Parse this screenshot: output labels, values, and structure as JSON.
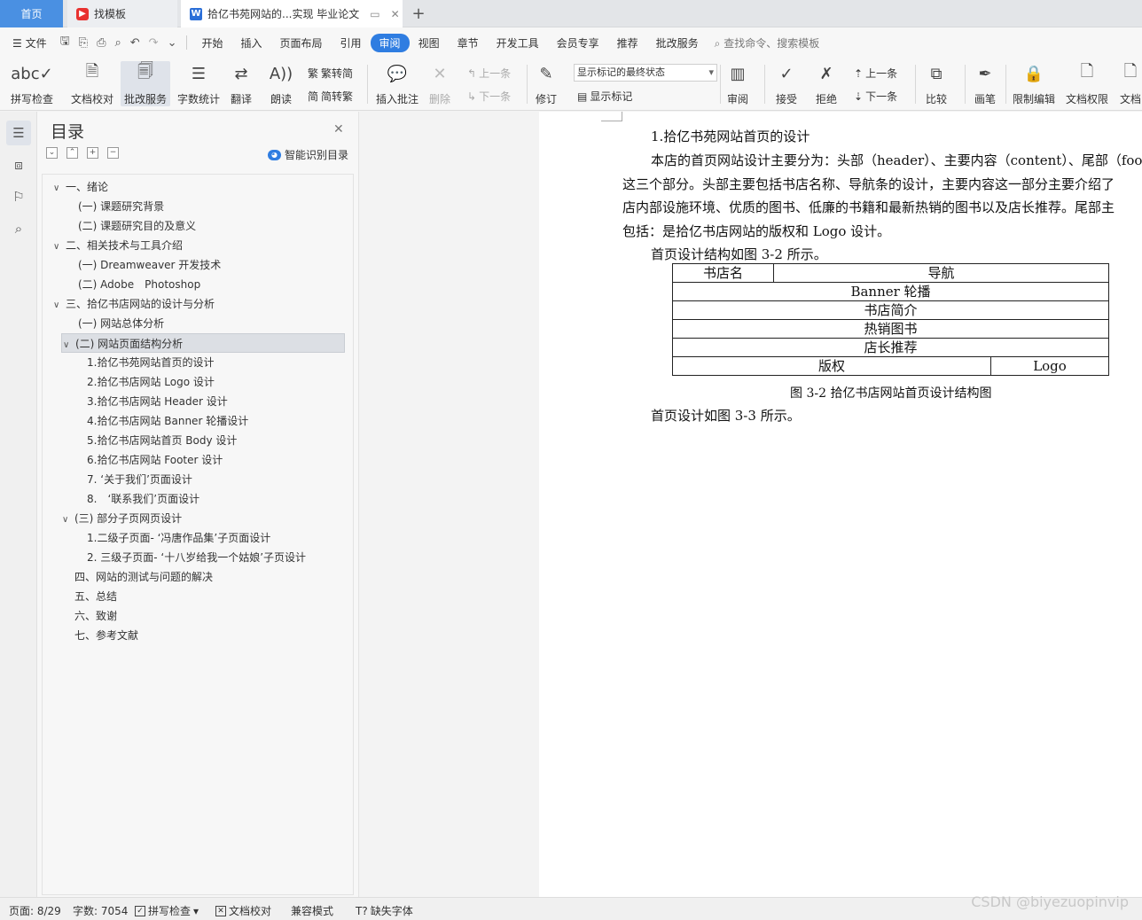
{
  "tabs": {
    "home": "首页",
    "templates": "找模板",
    "document": "拾亿书苑网站的...实现 毕业论文"
  },
  "menu": {
    "file": "文件",
    "items": [
      "开始",
      "插入",
      "页面布局",
      "引用",
      "审阅",
      "视图",
      "章节",
      "开发工具",
      "会员专享",
      "推荐",
      "批改服务"
    ],
    "active": "审阅",
    "search": "查找命令、搜索模板"
  },
  "ribbon": {
    "spellcheck": "拼写检查",
    "doc_proof": "文档校对",
    "correct_service": "批改服务",
    "word_count": "字数统计",
    "translate": "翻译",
    "read_aloud": "朗读",
    "trad_to_simp": "繁转简",
    "simp_to_trad": "简转繁",
    "insert_comment": "插入批注",
    "delete": "删除",
    "prev_comment": "上一条",
    "next_comment": "下一条",
    "revise": "修订",
    "markup_state": "显示标记的最终状态",
    "show_markup": "显示标记",
    "review": "审阅",
    "accept": "接受",
    "reject": "拒绝",
    "prev_change": "上一条",
    "next_change": "下一条",
    "compare": "比较",
    "pen": "画笔",
    "restrict_edit": "限制编辑",
    "doc_permission": "文档权限",
    "doc_more": "文档"
  },
  "toc": {
    "title": "目录",
    "smart": "智能识别目录",
    "items": [
      {
        "text": "一、绪论"
      },
      {
        "text": "(一) 课题研究背景"
      },
      {
        "text": "(二) 课题研究目的及意义"
      },
      {
        "text": "二、相关技术与工具介绍"
      },
      {
        "text": "(一) Dreamweaver 开发技术"
      },
      {
        "text": "(二) Adobe　Photoshop"
      },
      {
        "text": "三、拾亿书店网站的设计与分析"
      },
      {
        "text": "(一) 网站总体分析"
      },
      {
        "text": "(二) 网站页面结构分析"
      },
      {
        "text": "1.拾亿书苑网站首页的设计"
      },
      {
        "text": "2.拾亿书店网站 Logo 设计"
      },
      {
        "text": "3.拾亿书店网站 Header 设计"
      },
      {
        "text": "4.拾亿书店网站 Banner 轮播设计"
      },
      {
        "text": "5.拾亿书店网站首页 Body 设计"
      },
      {
        "text": "6.拾亿书店网站 Footer 设计"
      },
      {
        "text": "7. ‘关于我们’页面设计"
      },
      {
        "text": "8.　‘联系我们’页面设计"
      },
      {
        "text": "(三) 部分子页网页设计"
      },
      {
        "text": "1.二级子页面- ‘冯唐作品集’子页面设计"
      },
      {
        "text": "2. 三级子页面- ‘十八岁给我一个姑娘’子页设计"
      },
      {
        "text": "四、网站的测试与问题的解决"
      },
      {
        "text": "五、总结"
      },
      {
        "text": "六、致谢"
      },
      {
        "text": "七、参考文献"
      }
    ]
  },
  "document": {
    "heading": "1.拾亿书苑网站首页的设计",
    "para1_line1": "本店的首页网站设计主要分为：头部（header）、主要内容（content）、尾部（foote",
    "para1_line2": "这三个部分。头部主要包括书店名称、导航条的设计，主要内容这一部分主要介绍了",
    "para1_line3": "店内部设施环境、优质的图书、低廉的书籍和最新热销的图书以及店长推荐。尾部主",
    "para1_line4": "包括：是拾亿书店网站的版权和 Logo 设计。",
    "para2": "首页设计结构如图 3-2 所示。",
    "table": {
      "r1c1": "书店名",
      "r1c2": "导航",
      "r2": "Banner 轮播",
      "r3": "书店简介",
      "r4": "热销图书",
      "r5": "店长推荐",
      "r6c1": "版权",
      "r6c2": "Logo"
    },
    "caption": "图 3-2  拾亿书店网站首页设计结构图",
    "para3": "首页设计如图 3-3 所示。"
  },
  "status": {
    "page": "页面: 8/29",
    "words": "字数: 7054",
    "spellcheck": "拼写检查",
    "proof": "文档校对",
    "compat": "兼容模式",
    "missing_font": "缺失字体"
  },
  "watermark": "CSDN @biyezuopinvip"
}
